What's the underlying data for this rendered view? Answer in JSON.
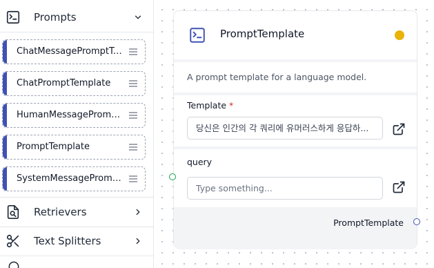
{
  "sidebar": {
    "categories": [
      {
        "label": "Prompts",
        "icon": "terminal-square-icon",
        "chevron": "chevron-down-icon"
      },
      {
        "label": "Retrievers",
        "icon": "file-search-icon",
        "chevron": "chevron-right-icon"
      },
      {
        "label": "Text Splitters",
        "icon": "scissors-icon",
        "chevron": "chevron-right-icon"
      }
    ],
    "items": [
      {
        "label": "ChatMessagePromptTe..."
      },
      {
        "label": "ChatPromptTemplate"
      },
      {
        "label": "HumanMessagePrompt..."
      },
      {
        "label": "PromptTemplate"
      },
      {
        "label": "SystemMessagePrompt..."
      }
    ],
    "accent_color": "#3f51b5"
  },
  "node": {
    "title": "PromptTemplate",
    "icon": "terminal-square-icon",
    "status_color": "#eab308",
    "description": "A prompt template for a language model.",
    "template": {
      "label": "Template",
      "required_mark": "*",
      "value": "당신은 인간의 각 쿼리에 유머러스하게 응답하..."
    },
    "query": {
      "label": "query",
      "placeholder": "Type something..."
    },
    "output_label": "PromptTemplate"
  }
}
